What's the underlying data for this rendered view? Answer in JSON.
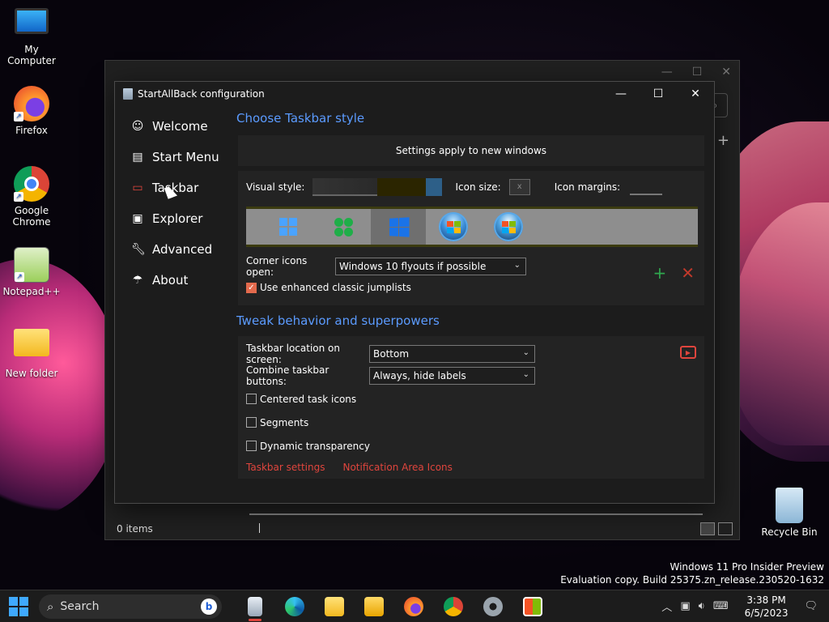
{
  "desktop": {
    "icons": [
      {
        "label": "My Computer"
      },
      {
        "label": "Firefox"
      },
      {
        "label": "Google Chrome"
      },
      {
        "label": "Notepad++"
      },
      {
        "label": "New folder"
      },
      {
        "label": "Recycle Bin"
      }
    ],
    "watermark": {
      "line1": "Windows 11 Pro Insider Preview",
      "line2": "Evaluation copy. Build 25375.zn_release.230520-1632"
    }
  },
  "explorer": {
    "status": "0 items"
  },
  "sab": {
    "title": "StartAllBack configuration",
    "nav": [
      {
        "label": "Welcome",
        "icon": "smile-icon"
      },
      {
        "label": "Start Menu",
        "icon": "start-menu-icon"
      },
      {
        "label": "Taskbar",
        "icon": "taskbar-icon"
      },
      {
        "label": "Explorer",
        "icon": "explorer-icon"
      },
      {
        "label": "Advanced",
        "icon": "wrench-icon"
      },
      {
        "label": "About",
        "icon": "about-icon"
      }
    ],
    "style_section": {
      "title": "Choose Taskbar style",
      "banner": "Settings apply to new windows",
      "visual_style_label": "Visual style:",
      "icon_size_label": "Icon size:",
      "icon_margins_label": "Icon margins:",
      "corner_icons_label": "Corner icons open:",
      "corner_icons_value": "Windows 10 flyouts if possible",
      "jumplists_label": "Use enhanced classic jumplists",
      "jumplists_checked": true
    },
    "tweak_section": {
      "title": "Tweak behavior and superpowers",
      "location_label": "Taskbar location on screen:",
      "location_value": "Bottom",
      "combine_label": "Combine taskbar buttons:",
      "combine_value": "Always, hide labels",
      "centered_label": "Centered task icons",
      "segments_label": "Segments",
      "transparency_label": "Dynamic transparency",
      "link_taskbar_settings": "Taskbar settings",
      "link_notification_icons": "Notification Area Icons"
    }
  },
  "taskbar": {
    "search_placeholder": "Search",
    "time": "3:38 PM",
    "date": "6/5/2023"
  },
  "colors": {
    "accent_blue": "#5b9bff",
    "accent_red": "#e0453d",
    "window_bg": "#1c1c1c"
  }
}
